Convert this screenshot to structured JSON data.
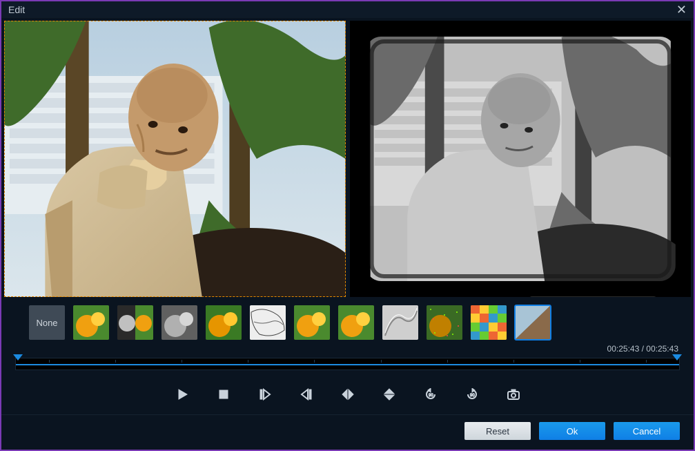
{
  "titlebar": {
    "title": "Edit"
  },
  "time": {
    "current": "00:25:43",
    "total": "00:25:43",
    "sep": " / "
  },
  "effects": {
    "none_label": "None",
    "items": [
      {
        "name": "effect-none"
      },
      {
        "name": "effect-color-1"
      },
      {
        "name": "effect-bw-split"
      },
      {
        "name": "effect-grayscale"
      },
      {
        "name": "effect-color-2"
      },
      {
        "name": "effect-sketch"
      },
      {
        "name": "effect-color-3"
      },
      {
        "name": "effect-color-4"
      },
      {
        "name": "effect-emboss"
      },
      {
        "name": "effect-noise"
      },
      {
        "name": "effect-pixelate"
      },
      {
        "name": "effect-oldfilm",
        "selected": true
      }
    ]
  },
  "footer": {
    "reset": "Reset",
    "ok": "Ok",
    "cancel": "Cancel"
  }
}
